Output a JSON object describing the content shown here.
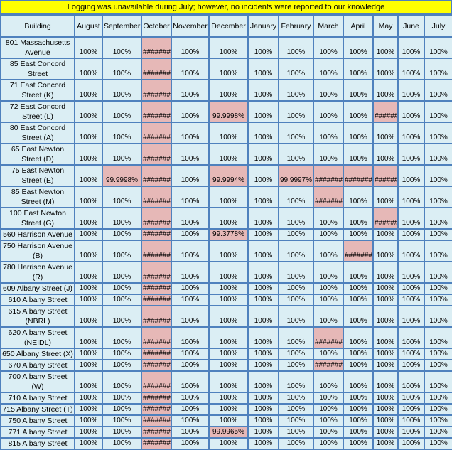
{
  "banner": "Logging was unavailable during July; however, no incidents were reported to our knowledge",
  "colors": {
    "banner": "#ffff00",
    "cell": "#dbeef4",
    "flagged": "#e6b8b7",
    "border": "#4f81bd"
  },
  "columns": [
    "Building",
    "August",
    "September",
    "October",
    "November",
    "December",
    "January",
    "February",
    "March",
    "April",
    "May",
    "June",
    "July"
  ],
  "rows": [
    {
      "building": "801 Massachusetts Avenue",
      "values": [
        "100%",
        "100%",
        "#######",
        "100%",
        "100%",
        "100%",
        "100%",
        "100%",
        "100%",
        "100%",
        "100%",
        "100%"
      ],
      "flagged": [
        2
      ]
    },
    {
      "building": "85 East Concord Street",
      "values": [
        "100%",
        "100%",
        "#######",
        "100%",
        "100%",
        "100%",
        "100%",
        "100%",
        "100%",
        "100%",
        "100%",
        "100%"
      ],
      "flagged": [
        2
      ]
    },
    {
      "building": "71 East Concord Street (K)",
      "values": [
        "100%",
        "100%",
        "#######",
        "100%",
        "100%",
        "100%",
        "100%",
        "100%",
        "100%",
        "100%",
        "100%",
        "100%"
      ],
      "flagged": [
        2
      ]
    },
    {
      "building": "72 East Concord Street (L)",
      "values": [
        "100%",
        "100%",
        "#######",
        "100%",
        "99.9998%",
        "100%",
        "100%",
        "100%",
        "100%",
        "######",
        "100%",
        "100%"
      ],
      "flagged": [
        2,
        4,
        9
      ]
    },
    {
      "building": "80 East Concord Street (A)",
      "values": [
        "100%",
        "100%",
        "#######",
        "100%",
        "100%",
        "100%",
        "100%",
        "100%",
        "100%",
        "100%",
        "100%",
        "100%"
      ],
      "flagged": [
        2
      ]
    },
    {
      "building": "65 East Newton Street (D)",
      "values": [
        "100%",
        "100%",
        "#######",
        "100%",
        "100%",
        "100%",
        "100%",
        "100%",
        "100%",
        "100%",
        "100%",
        "100%"
      ],
      "flagged": [
        2
      ]
    },
    {
      "building": "75 East Newton Street (E)",
      "values": [
        "100%",
        "99.9998%",
        "#######",
        "100%",
        "99.9994%",
        "100%",
        "99.9997%",
        "#######",
        "#######",
        "######",
        "100%",
        "100%"
      ],
      "flagged": [
        1,
        2,
        4,
        6,
        7,
        8,
        9
      ]
    },
    {
      "building": "85 East Newton Street (M)",
      "values": [
        "100%",
        "100%",
        "#######",
        "100%",
        "100%",
        "100%",
        "100%",
        "#######",
        "100%",
        "100%",
        "100%",
        "100%"
      ],
      "flagged": [
        2,
        7
      ]
    },
    {
      "building": "100 East Newton Street (G)",
      "values": [
        "100%",
        "100%",
        "#######",
        "100%",
        "100%",
        "100%",
        "100%",
        "100%",
        "100%",
        "######",
        "100%",
        "100%"
      ],
      "flagged": [
        2,
        9
      ]
    },
    {
      "building": "560 Harrison Avenue",
      "values": [
        "100%",
        "100%",
        "#######",
        "100%",
        "99.3778%",
        "100%",
        "100%",
        "100%",
        "100%",
        "100%",
        "100%",
        "100%"
      ],
      "flagged": [
        2,
        4
      ]
    },
    {
      "building": "750 Harrison Avenue (B)",
      "values": [
        "100%",
        "100%",
        "#######",
        "100%",
        "100%",
        "100%",
        "100%",
        "100%",
        "#######",
        "100%",
        "100%",
        "100%"
      ],
      "flagged": [
        2,
        8
      ]
    },
    {
      "building": "780 Harrison Avenue (R)",
      "values": [
        "100%",
        "100%",
        "#######",
        "100%",
        "100%",
        "100%",
        "100%",
        "100%",
        "100%",
        "100%",
        "100%",
        "100%"
      ],
      "flagged": [
        2
      ]
    },
    {
      "building": "609 Albany Street (J)",
      "values": [
        "100%",
        "100%",
        "#######",
        "100%",
        "100%",
        "100%",
        "100%",
        "100%",
        "100%",
        "100%",
        "100%",
        "100%"
      ],
      "flagged": [
        2
      ]
    },
    {
      "building": "610 Albany Street",
      "values": [
        "100%",
        "100%",
        "#######",
        "100%",
        "100%",
        "100%",
        "100%",
        "100%",
        "100%",
        "100%",
        "100%",
        "100%"
      ],
      "flagged": [
        2
      ]
    },
    {
      "building": "615 Albany Street (NBRL)",
      "values": [
        "100%",
        "100%",
        "#######",
        "100%",
        "100%",
        "100%",
        "100%",
        "100%",
        "100%",
        "100%",
        "100%",
        "100%"
      ],
      "flagged": [
        2
      ]
    },
    {
      "building": "620 Albany Street (NEIDL)",
      "values": [
        "100%",
        "100%",
        "#######",
        "100%",
        "100%",
        "100%",
        "100%",
        "#######",
        "100%",
        "100%",
        "100%",
        "100%"
      ],
      "flagged": [
        2,
        7
      ]
    },
    {
      "building": "650 Albany Street (X)",
      "values": [
        "100%",
        "100%",
        "#######",
        "100%",
        "100%",
        "100%",
        "100%",
        "100%",
        "100%",
        "100%",
        "100%",
        "100%"
      ],
      "flagged": [
        2
      ]
    },
    {
      "building": "670 Albany Street",
      "values": [
        "100%",
        "100%",
        "#######",
        "100%",
        "100%",
        "100%",
        "100%",
        "#######",
        "100%",
        "100%",
        "100%",
        "100%"
      ],
      "flagged": [
        2,
        7
      ]
    },
    {
      "building": "700 Albany Street (W)",
      "values": [
        "100%",
        "100%",
        "#######",
        "100%",
        "100%",
        "100%",
        "100%",
        "100%",
        "100%",
        "100%",
        "100%",
        "100%"
      ],
      "flagged": [
        2
      ]
    },
    {
      "building": "710 Albany Street",
      "values": [
        "100%",
        "100%",
        "#######",
        "100%",
        "100%",
        "100%",
        "100%",
        "100%",
        "100%",
        "100%",
        "100%",
        "100%"
      ],
      "flagged": [
        2
      ]
    },
    {
      "building": "715 Albany Street (T)",
      "values": [
        "100%",
        "100%",
        "#######",
        "100%",
        "100%",
        "100%",
        "100%",
        "100%",
        "100%",
        "100%",
        "100%",
        "100%"
      ],
      "flagged": [
        2
      ]
    },
    {
      "building": "750 Albany Street",
      "values": [
        "100%",
        "100%",
        "#######",
        "100%",
        "100%",
        "100%",
        "100%",
        "100%",
        "100%",
        "100%",
        "100%",
        "100%"
      ],
      "flagged": [
        2
      ]
    },
    {
      "building": "771 Albany Street",
      "values": [
        "100%",
        "100%",
        "#######",
        "100%",
        "99.9965%",
        "100%",
        "100%",
        "100%",
        "100%",
        "100%",
        "100%",
        "100%"
      ],
      "flagged": [
        2,
        4
      ]
    },
    {
      "building": "815 Albany Street",
      "values": [
        "100%",
        "100%",
        "#######",
        "100%",
        "100%",
        "100%",
        "100%",
        "100%",
        "100%",
        "100%",
        "100%",
        "100%"
      ],
      "flagged": [
        2
      ]
    }
  ]
}
